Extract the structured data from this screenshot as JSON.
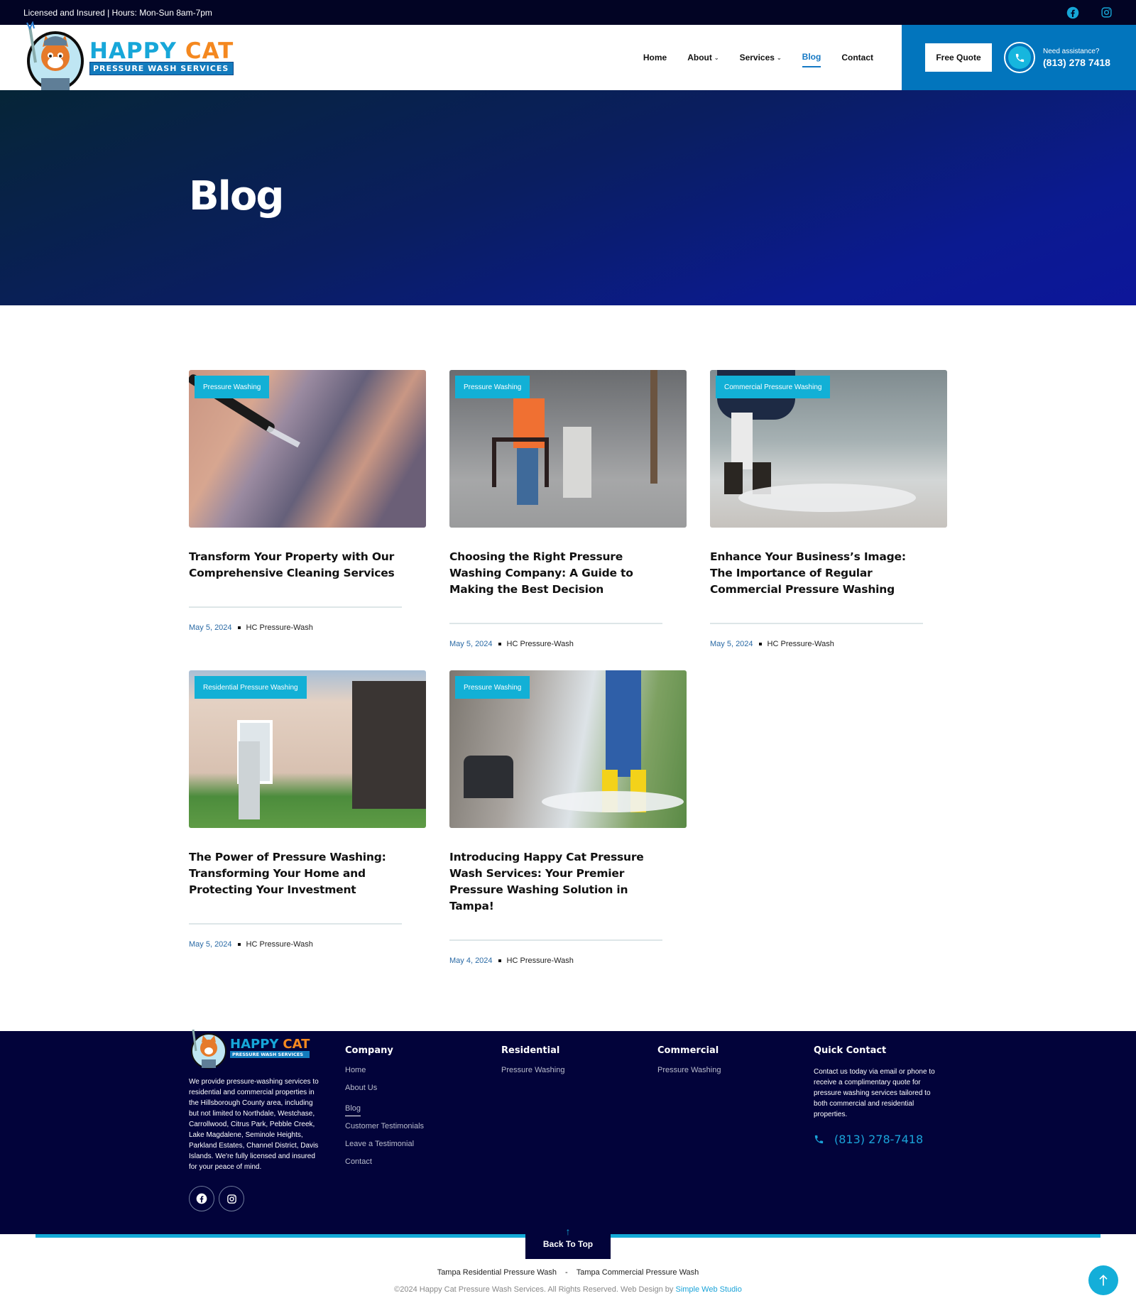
{
  "topbar": {
    "text": "Licensed and Insured | Hours: Mon-Sun 8am-7pm",
    "social": [
      "facebook-icon",
      "instagram-icon"
    ]
  },
  "brand": {
    "name_part1": "HAPPY",
    "name_part2": "CAT",
    "tagline": "PRESSURE WASH SERVICES",
    "colors": {
      "blue": "#17a7d9",
      "orange": "#f4881f",
      "navy": "#02033a",
      "header_blue": "#0275bd"
    }
  },
  "nav": {
    "items": [
      {
        "label": "Home",
        "dropdown": false,
        "active": false
      },
      {
        "label": "About",
        "dropdown": true,
        "active": false
      },
      {
        "label": "Services",
        "dropdown": true,
        "active": false
      },
      {
        "label": "Blog",
        "dropdown": false,
        "active": true
      },
      {
        "label": "Contact",
        "dropdown": false,
        "active": false
      }
    ],
    "cta_label": "Free Quote",
    "assist_label": "Need assistance?",
    "assist_phone": "(813) 278 7418"
  },
  "hero": {
    "title": "Blog"
  },
  "posts": [
    {
      "category": "Pressure Washing",
      "title": "Transform Your Property with Our Comprehensive Cleaning Services",
      "date": "May 5, 2024",
      "author": "HC Pressure-Wash"
    },
    {
      "category": "Pressure Washing",
      "title": "Choosing the Right Pressure Washing Company: A Guide to Making the Best Decision",
      "date": "May 5, 2024",
      "author": "HC Pressure-Wash"
    },
    {
      "category": "Commercial Pressure Washing",
      "title": "Enhance Your Business’s Image: The Importance of Regular Commercial Pressure Washing",
      "date": "May 5, 2024",
      "author": "HC Pressure-Wash"
    },
    {
      "category": "Residential Pressure Washing",
      "title": "The Power of Pressure Washing: Transforming Your Home and Protecting Your Investment",
      "date": "May 5, 2024",
      "author": "HC Pressure-Wash"
    },
    {
      "category": "Pressure Washing",
      "title": "Introducing Happy Cat Pressure Wash Services: Your Premier Pressure Washing Solution in Tampa!",
      "date": "May 4, 2024",
      "author": "HC Pressure-Wash"
    }
  ],
  "footer": {
    "about": "We provide pressure-washing services to residential and commercial properties in the Hillsborough County area, including but not limited to Northdale, Westchase, Carrollwood, Citrus Park, Pebble Creek, Lake Magdalene, Seminole Heights, Parkland Estates, Channel District, Davis Islands. We're fully licensed and insured for your peace of mind.",
    "company": {
      "heading": "Company",
      "links": [
        "Home",
        "About Us",
        "Blog",
        "Customer Testimonials",
        "Leave a Testimonial",
        "Contact"
      ]
    },
    "residential": {
      "heading": "Residential",
      "links": [
        "Pressure Washing"
      ]
    },
    "commercial": {
      "heading": "Commercial",
      "links": [
        "Pressure Washing"
      ]
    },
    "quick_contact": {
      "heading": "Quick Contact",
      "text": "Contact us today via email or phone to receive a complimentary quote for pressure washing services tailored to both commercial and residential properties.",
      "phone": "(813) 278-7418"
    },
    "back_to_top": "Back To Top",
    "bottom_links": [
      "Tampa Residential Pressure Wash",
      "-",
      "Tampa Commercial Pressure Wash"
    ],
    "copyright": "©2024 Happy Cat Pressure Wash Services. All Rights Reserved. Web Design by ",
    "credit_link": "Simple Web Studio"
  }
}
